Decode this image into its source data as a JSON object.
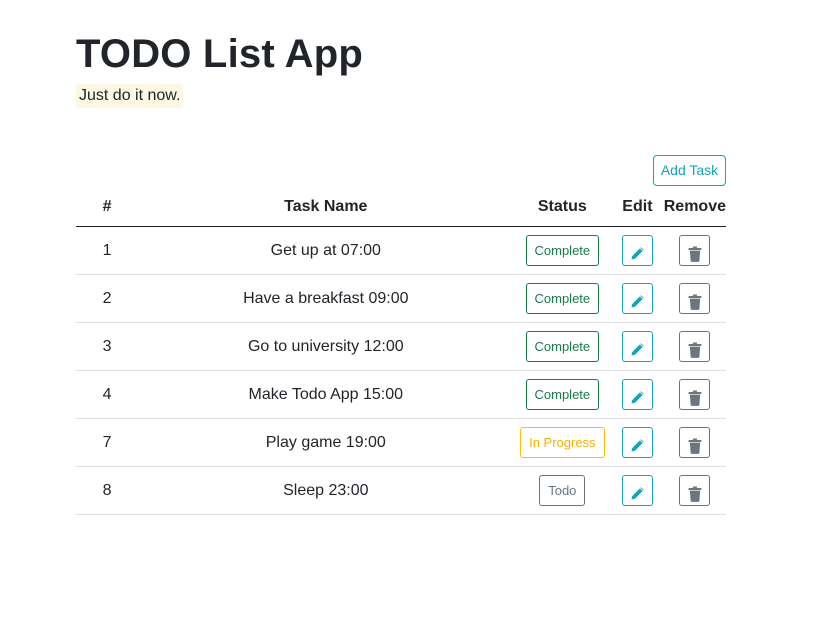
{
  "header": {
    "title": "TODO List App",
    "subtitle": "Just do it now."
  },
  "toolbar": {
    "add_task_label": "Add Task"
  },
  "table": {
    "columns": [
      "#",
      "Task Name",
      "Status",
      "Edit",
      "Remove"
    ],
    "rows": [
      {
        "num": "1",
        "name": "Get up at 07:00",
        "status": "Complete",
        "status_kind": "complete"
      },
      {
        "num": "2",
        "name": "Have a breakfast 09:00",
        "status": "Complete",
        "status_kind": "complete"
      },
      {
        "num": "3",
        "name": "Go to university 12:00",
        "status": "Complete",
        "status_kind": "complete"
      },
      {
        "num": "4",
        "name": "Make Todo App 15:00",
        "status": "Complete",
        "status_kind": "complete"
      },
      {
        "num": "7",
        "name": "Play game 19:00",
        "status": "In Progress",
        "status_kind": "progress"
      },
      {
        "num": "8",
        "name": "Sleep 23:00",
        "status": "Todo",
        "status_kind": "todo"
      }
    ]
  },
  "icons": {
    "edit": "pencil-icon",
    "remove": "trash-icon"
  },
  "colors": {
    "accent": "#17a2b8",
    "complete": "#1a7a4c",
    "progress": "#ffc107",
    "todo": "#6c757d",
    "highlight": "#fcf8e3"
  }
}
